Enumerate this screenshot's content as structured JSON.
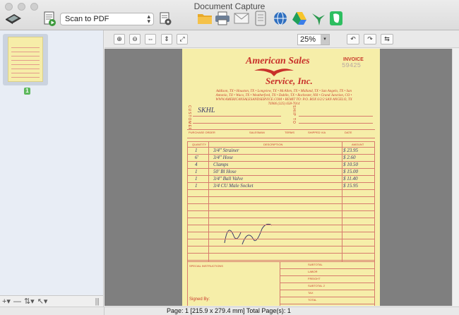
{
  "window": {
    "title": "Document Capture"
  },
  "toolbar": {
    "scan_profile": "Scan to PDF",
    "destinations": [
      "folder-icon",
      "printer-icon",
      "mail-icon",
      "document-icon",
      "web-icon",
      "google-drive-icon",
      "hummingbird-icon",
      "evernote-icon"
    ]
  },
  "viewer": {
    "zoom": "25%"
  },
  "sidebar": {
    "page_badge": "1"
  },
  "document": {
    "company_line1": "American Sales",
    "company_line2": "Service, Inc.",
    "address": "Addison, TX • Houston, TX • Longview, TX • McAllen, TX • Midland, TX • San Angelo, TX • San Antonio, TX • Waco, TX • Weatherford, TX • Dublin, TX • Rochester, NH • Grand Junction, CO • WWW.AMERICANSALESANDSERVICE.COM • REMIT TO: P.O. BOX 6/2/2 SAN ANGELO, TX 76906 (325) 658-7014",
    "invoice_label": "INVOICE",
    "invoice_number": "59425",
    "customer_label": "CUSTOMER",
    "ship_to_label": "SHIP TO",
    "customer_name": "SKHL",
    "header_fields": [
      "PURCHASE ORDER",
      "SALESMAN",
      "TERMS",
      "SHIPPED VIA",
      "DATE"
    ],
    "columns": [
      "QUANTITY",
      "DESCRIPTION",
      "AMOUNT"
    ],
    "items": [
      {
        "qty": "1",
        "desc": "3/4\" Strainer",
        "amount": "$ 23.95"
      },
      {
        "qty": "6'",
        "desc": "3/4\" Hose",
        "amount": "$ 2.60"
      },
      {
        "qty": "4",
        "desc": "Clamps",
        "amount": "$ 10.50"
      },
      {
        "qty": "1",
        "desc": "50' Bl Hose",
        "amount": "$ 15.00"
      },
      {
        "qty": "1",
        "desc": "3/4\" Ball Valve",
        "amount": "$ 11.40"
      },
      {
        "qty": "1",
        "desc": "3/4 CU Male Socket",
        "amount": "$ 15.95"
      }
    ],
    "special_instructions": "SPECIAL INSTRUCTIONS",
    "signed_by": "Signed By:",
    "totals_labels": [
      "SUBTOTAL",
      "LABOR",
      "FREIGHT",
      "SUBTOTAL 2",
      "TAX",
      "TOTAL"
    ]
  },
  "status": {
    "text": "Page: 1  [215.9 x 279.4 mm]  Total Page(s): 1"
  }
}
